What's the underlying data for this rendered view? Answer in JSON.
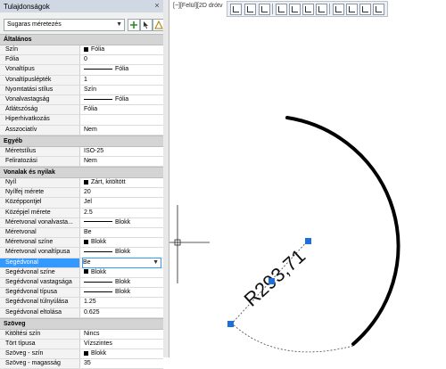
{
  "palette": {
    "title": "Tulajdonságok",
    "close_glyph": "×",
    "object_select": "Sugaras méretezés",
    "sections": [
      {
        "label": "Általános",
        "rows": [
          {
            "name": "Szín",
            "value": "Fólia",
            "swatch": "#000000"
          },
          {
            "name": "Fólia",
            "value": "0"
          },
          {
            "name": "Vonaltípus",
            "value": "Fólia",
            "line": true
          },
          {
            "name": "Vonaltípuslépték",
            "value": "1"
          },
          {
            "name": "Nyomtatási stílus",
            "value": "Szín"
          },
          {
            "name": "Vonalvastagság",
            "value": "Fólia",
            "line": true
          },
          {
            "name": "Átlátszóság",
            "value": "Fólia"
          },
          {
            "name": "Hiperhivatkozás",
            "value": ""
          },
          {
            "name": "Asszociatív",
            "value": "Nem"
          }
        ]
      },
      {
        "label": "Egyéb",
        "rows": [
          {
            "name": "Méretstílus",
            "value": "ISO-25"
          },
          {
            "name": "Feliratozási",
            "value": "Nem"
          }
        ]
      },
      {
        "label": "Vonalak és nyilak",
        "rows": [
          {
            "name": "Nyíl",
            "value": "Zárt, kitöltött",
            "swatch": "#000000"
          },
          {
            "name": "Nyílfej mérete",
            "value": "20"
          },
          {
            "name": "Középpontjel",
            "value": "Jel"
          },
          {
            "name": "Középjel mérete",
            "value": "2.5"
          },
          {
            "name": "Méretvonal vonalvasta...",
            "value": "Blokk",
            "line": true
          },
          {
            "name": "Méretvonal",
            "value": "Be"
          },
          {
            "name": "Méretvonal színe",
            "value": "Blokk",
            "swatch": "#000000"
          },
          {
            "name": "Méretvonal vonaltípusa",
            "value": "Blokk",
            "line": true
          },
          {
            "name": "Segédvonal",
            "value": "Be",
            "selected": true
          },
          {
            "name": "Segédvonal színe",
            "value": "Blokk",
            "swatch": "#000000"
          },
          {
            "name": "Segédvonal vastagsága",
            "value": "Blokk",
            "line": true
          },
          {
            "name": "Segédvonal típusa",
            "value": "Blokk",
            "line": true
          },
          {
            "name": "Segédvonal túlnyúlása",
            "value": "1.25"
          },
          {
            "name": "Segédvonal eltolása",
            "value": "0.625"
          }
        ]
      },
      {
        "label": "Szöveg",
        "rows": [
          {
            "name": "Kitöltési szín",
            "value": "Nincs"
          },
          {
            "name": "Tört típusa",
            "value": "Vízszintes"
          },
          {
            "name": "Szöveg - szín",
            "value": "Blokk",
            "swatch": "#000000"
          },
          {
            "name": "Szöveg - magasság",
            "value": "35"
          }
        ]
      }
    ]
  },
  "viewport": {
    "label": "[−][Felül][2D drótv",
    "dimension_text": "R293,71",
    "accent_color": "#1e6fd9"
  }
}
